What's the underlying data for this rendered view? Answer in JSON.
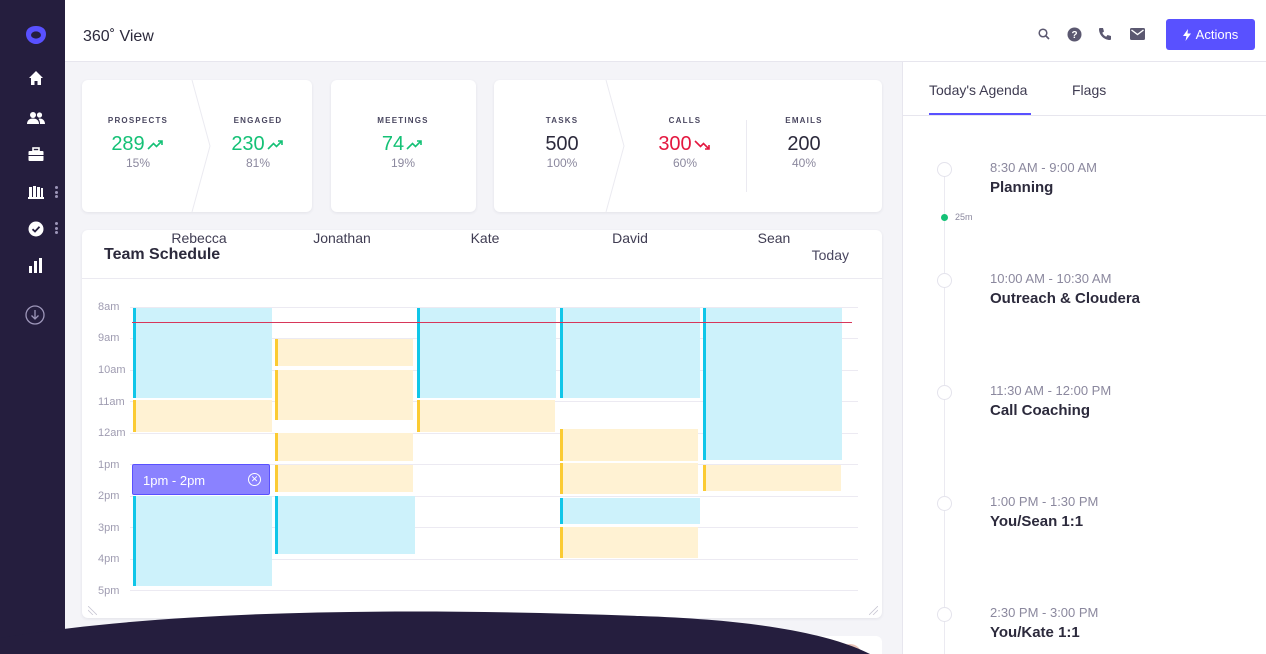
{
  "header": {
    "title": "360˚ View",
    "actions_label": "Actions"
  },
  "colors": {
    "accent": "#5951ff",
    "sidebar": "#251e3e",
    "positive": "#14c176",
    "negative": "#e4173f",
    "meeting": "#10c6e8",
    "task": "#fbcb33"
  },
  "sidebar": {
    "items": [
      {
        "icon": "home-icon"
      },
      {
        "icon": "people-icon"
      },
      {
        "icon": "briefcase-icon"
      },
      {
        "icon": "library-icon"
      },
      {
        "icon": "check-circle-icon"
      },
      {
        "icon": "bar-chart-icon"
      },
      {
        "icon": "download-circle-icon"
      }
    ]
  },
  "metrics": {
    "prospects": {
      "label": "PROSPECTS",
      "value": "289",
      "pct": "15%",
      "trend": "up"
    },
    "engaged": {
      "label": "ENGAGED",
      "value": "230",
      "pct": "81%",
      "trend": "up"
    },
    "meetings": {
      "label": "MEETINGS",
      "value": "74",
      "pct": "19%",
      "trend": "up"
    },
    "tasks": {
      "label": "TASKS",
      "value": "500",
      "pct": "100%"
    },
    "calls": {
      "label": "CALLS",
      "value": "300",
      "pct": "60%",
      "trend": "down"
    },
    "emails": {
      "label": "EMAILS",
      "value": "200",
      "pct": "40%"
    }
  },
  "schedule": {
    "title": "Team Schedule",
    "today_label": "Today",
    "people": [
      "Rebecca",
      "Jonathan",
      "Kate",
      "David",
      "Sean"
    ],
    "hours": [
      "8am",
      "9am",
      "10am",
      "11am",
      "12am",
      "1pm",
      "2pm",
      "3pm",
      "4pm",
      "5pm"
    ],
    "selected_event": "1pm - 2pm"
  },
  "agenda": {
    "tabs": [
      "Today's Agenda",
      "Flags"
    ],
    "now_label": "25m",
    "items": [
      {
        "time": "8:30 AM - 9:00 AM",
        "title": "Planning"
      },
      {
        "time": "10:00 AM - 10:30 AM",
        "title": "Outreach & Cloudera"
      },
      {
        "time": "11:30 AM - 12:00 PM",
        "title": "Call Coaching"
      },
      {
        "time": "1:00 PM - 1:30 PM",
        "title": "You/Sean 1:1"
      },
      {
        "time": "2:30 PM - 3:00 PM",
        "title": "You/Kate 1:1"
      }
    ]
  }
}
